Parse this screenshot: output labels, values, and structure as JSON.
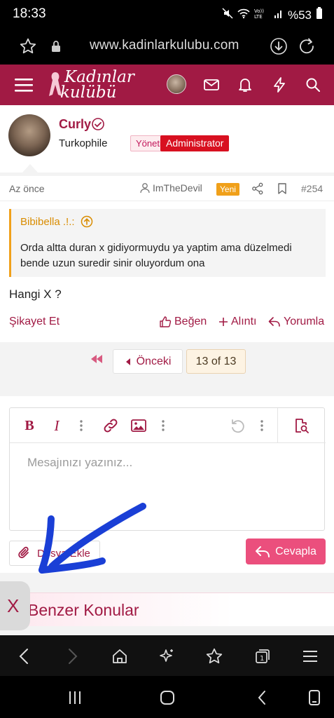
{
  "status_bar": {
    "time": "18:33",
    "battery": "%53"
  },
  "browser": {
    "url": "www.kadinlarkulubu.com"
  },
  "site": {
    "logo_line1": "Kadınlar",
    "logo_line2": "kulübü",
    "brand_color": "#a11a44"
  },
  "user": {
    "name": "Curly",
    "title": "Turkophile",
    "badge_role": "Yönetici",
    "badge_admin": "Administrator"
  },
  "post": {
    "time": "Az önce",
    "author": "ImTheDevil",
    "new_badge": "Yeni",
    "number": "#254",
    "quote_author": "Bibibella .!.:",
    "quote_text": "Orda altta duran x gidiyormuydu ya yaptim ama düzelmedi bende uzun suredir sinir oluyordum ona",
    "body": "Hangi X ?",
    "actions": {
      "report": "Şikayet Et",
      "like": "Beğen",
      "quote": "Alıntı",
      "reply": "Yorumla"
    }
  },
  "pagination": {
    "prev": "Önceki",
    "current": "13 of 13"
  },
  "editor": {
    "bold": "B",
    "italic": "I",
    "placeholder": "Mesajınızı yazınız..."
  },
  "reply": {
    "attach": "Dosya Ekle",
    "submit": "Cevapla"
  },
  "similar": {
    "title": "Benzer Konular",
    "close": "X"
  },
  "annotation": {
    "arrow_color": "#1a3fd6"
  }
}
